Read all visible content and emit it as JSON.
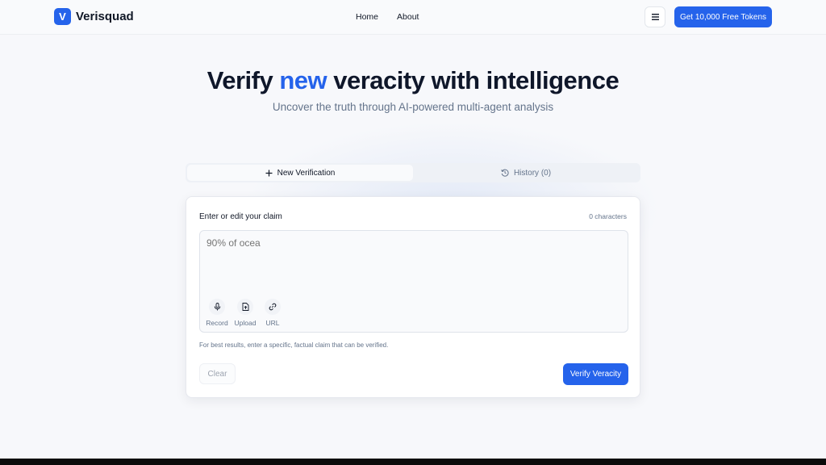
{
  "brand": {
    "logo_letter": "V",
    "name": "Verisquad"
  },
  "nav": {
    "home": "Home",
    "about": "About"
  },
  "header": {
    "menu_icon": "hamburger-icon",
    "cta_label": "Get 10,000 Free Tokens"
  },
  "hero": {
    "title_start": "Verify ",
    "title_accent": "new",
    "title_end": " veracity with intelligence",
    "subtitle": "Uncover the truth through AI-powered multi-agent analysis"
  },
  "tabs": [
    {
      "label": "New Verification",
      "icon": "plus-icon",
      "active": true
    },
    {
      "label": "History (0)",
      "icon": "history-icon",
      "active": false
    }
  ],
  "form": {
    "label": "Enter or edit your claim",
    "char_count": "0 characters",
    "claim_placeholder": "90% of ocea",
    "tools": [
      {
        "label": "Record",
        "icon": "microphone-icon"
      },
      {
        "label": "Upload",
        "icon": "file-upload-icon"
      },
      {
        "label": "URL",
        "icon": "link-icon"
      }
    ],
    "hint": "For best results, enter a specific, factual claim that can be verified.",
    "clear_label": "Clear",
    "verify_label": "Verify Veracity"
  },
  "colors": {
    "accent": "#2563eb",
    "text": "#111827",
    "muted": "#64748b",
    "background": "#f7f8fb"
  }
}
